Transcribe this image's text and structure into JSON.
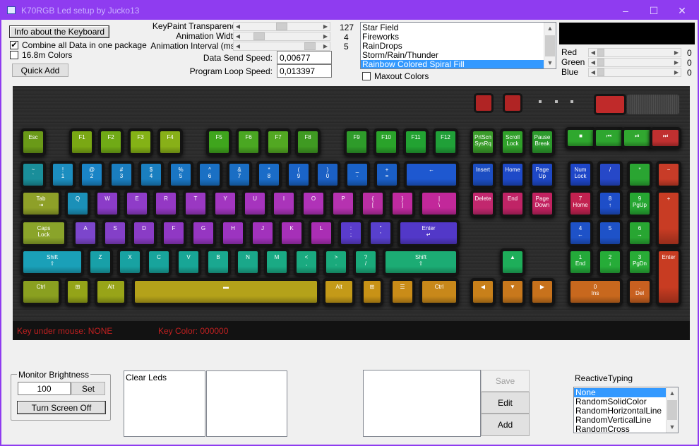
{
  "window": {
    "title": "K70RGB Led setup by Jucko13",
    "minimize": "‒",
    "maximize": "☐",
    "close": "✕"
  },
  "top": {
    "info_button": "Info about the Keyboard",
    "combine_label": "Combine all Data in one package",
    "combine_checked": "✔",
    "colors_label": "16.8m Colors",
    "quick_add": "Quick Add",
    "transparency_label": "KeyPaint Transparency",
    "transparency_value": "127",
    "width_label": "Animation Width:",
    "width_value": "4",
    "interval_label": "Animation Interval (ms):",
    "interval_value": "5",
    "send_label": "Data Send Speed:",
    "send_value": "0,00677",
    "loop_label": "Program Loop Speed:",
    "loop_value": "0,013397"
  },
  "effects": {
    "items": [
      "Star Field",
      "Fireworks",
      "RainDrops",
      "Storm/Rain/Thunder",
      "Rainbow Colored Spiral Fill"
    ],
    "selected": 4
  },
  "maxout_label": "Maxout Colors",
  "rgb": {
    "red_label": "Red",
    "green_label": "Green",
    "blue_label": "Blue",
    "red": "0",
    "green": "0",
    "blue": "0"
  },
  "keyboard": {
    "status_key": "Key under mouse: NONE",
    "status_color": "Key Color: 000000"
  },
  "monitor": {
    "title": "Monitor Brightness",
    "value": "100",
    "set": "Set",
    "turn_off": "Turn Screen Off"
  },
  "macros": {
    "items": [
      "Clear Leds"
    ]
  },
  "editor": {
    "save": "Save",
    "edit": "Edit",
    "add": "Add"
  },
  "reactive": {
    "title": "ReactiveTyping",
    "items": [
      "None",
      "RandomSolidColor",
      "RandomHorizontalLine",
      "RandomVerticalLine",
      "RandomCross"
    ],
    "selected": 0
  },
  "colors": {
    "accent": "#8f3cf0",
    "selection": "#3399ff",
    "status_text": "#c02020"
  },
  "keys": [
    {
      "l": "Esc",
      "b": "#6a9a18"
    },
    {
      "l": "F1",
      "b": "#7aa814"
    },
    {
      "l": "F2",
      "b": "#70aa16"
    },
    {
      "l": "F3",
      "b": "#84b216"
    },
    {
      "l": "F4",
      "b": "#88b018"
    },
    {
      "l": "F5",
      "b": "#3fa51d"
    },
    {
      "l": "F6",
      "b": "#4aa722"
    },
    {
      "l": "F7",
      "b": "#52a822"
    },
    {
      "l": "F8",
      "b": "#3f9a22"
    },
    {
      "l": "F9",
      "b": "#2e9b2a"
    },
    {
      "l": "F10",
      "b": "#2aa32a"
    },
    {
      "l": "F11",
      "b": "#22a232"
    },
    {
      "l": "F12",
      "b": "#20a038"
    },
    {
      "l": "PrtScn SysRq",
      "b": "#3a9b2a"
    },
    {
      "l": "Scroll Lock",
      "b": "#30a02a"
    },
    {
      "l": "Pause Break",
      "b": "#2c9a2c"
    },
    {
      "l": "■",
      "b": "#2fa82e"
    },
    {
      "l": "⏮",
      "b": "#2ea62f"
    },
    {
      "l": "⏯",
      "b": "#31a730"
    },
    {
      "l": "⏭",
      "b": "#c03030"
    },
    {
      "l": "~ `",
      "b": "#1a8e9a"
    },
    {
      "l": "! 1",
      "b": "#1c8ec0"
    },
    {
      "l": "@ 2",
      "b": "#1a84c6"
    },
    {
      "l": "# 3",
      "b": "#1a7ec0"
    },
    {
      "l": "$ 4",
      "b": "#1a7fc0"
    },
    {
      "l": "% 5",
      "b": "#1a76c4"
    },
    {
      "l": "^ 6",
      "b": "#1a70c4"
    },
    {
      "l": "& 7",
      "b": "#1a6ec4"
    },
    {
      "l": "* 8",
      "b": "#1a6cc8"
    },
    {
      "l": "( 9",
      "b": "#1a64c8"
    },
    {
      "l": ") 0",
      "b": "#1b60c4"
    },
    {
      "l": "_ -",
      "b": "#1a62c8"
    },
    {
      "l": "+ =",
      "b": "#1a5ec6"
    },
    {
      "l": "←",
      "b": "#1e58d0"
    },
    {
      "l": "Insert",
      "b": "#1c4ec2"
    },
    {
      "l": "Home",
      "b": "#1e4ac8"
    },
    {
      "l": "Page Up",
      "b": "#1e48c6"
    },
    {
      "l": "Num Lock",
      "b": "#1e46c8"
    },
    {
      "l": "/",
      "b": "#2648c8"
    },
    {
      "l": "*",
      "b": "#2aa532"
    },
    {
      "l": "−",
      "b": "#c83c28"
    },
    {
      "l": "Tab ⇥",
      "b": "#8ea028"
    },
    {
      "l": "Q",
      "b": "#1b90b8"
    },
    {
      "l": "W",
      "b": "#8b3cc8"
    },
    {
      "l": "E",
      "b": "#8f3cc8"
    },
    {
      "l": "R",
      "b": "#9438c4"
    },
    {
      "l": "T",
      "b": "#9a38c2"
    },
    {
      "l": "Y",
      "b": "#a236c0"
    },
    {
      "l": "U",
      "b": "#a634be"
    },
    {
      "l": "I",
      "b": "#aa34ba"
    },
    {
      "l": "O",
      "b": "#b032b8"
    },
    {
      "l": "P",
      "b": "#b632b0"
    },
    {
      "l": "{ [",
      "b": "#ba2ea4"
    },
    {
      "l": "} ]",
      "b": "#c02aa0"
    },
    {
      "l": "| \\",
      "b": "#c2289a"
    },
    {
      "l": "Delete",
      "b": "#c2286e"
    },
    {
      "l": "End",
      "b": "#c02466"
    },
    {
      "l": "Page Down",
      "b": "#c22260"
    },
    {
      "l": "7 Home",
      "b": "#c22250"
    },
    {
      "l": "8 ↑",
      "b": "#1e4ec8"
    },
    {
      "l": "9 PgUp",
      "b": "#26a632"
    },
    {
      "l": "+",
      "b": "#c83c24"
    },
    {
      "l": "Caps Lock",
      "b": "#8aa42a"
    },
    {
      "l": "A",
      "b": "#7c46cc"
    },
    {
      "l": "S",
      "b": "#8440c8"
    },
    {
      "l": "D",
      "b": "#8a3cc6"
    },
    {
      "l": "F",
      "b": "#9038c4"
    },
    {
      "l": "G",
      "b": "#9636c2"
    },
    {
      "l": "H",
      "b": "#9c34c0"
    },
    {
      "l": "J",
      "b": "#a232bc"
    },
    {
      "l": "K",
      "b": "#a630b8"
    },
    {
      "l": "L",
      "b": "#aa2eb4"
    },
    {
      "l": ": ;",
      "b": "#5a3ccc"
    },
    {
      "l": "\" '",
      "b": "#5840ce"
    },
    {
      "l": "Enter ↵",
      "b": "#5238c8"
    },
    {
      "l": "4 ←",
      "b": "#1e52c8"
    },
    {
      "l": "5",
      "b": "#1e52c8"
    },
    {
      "l": "6 →",
      "b": "#28a632"
    },
    {
      "l": "Shift ⇧",
      "b": "#1aa0b8"
    },
    {
      "l": "Z",
      "b": "#18a0a8"
    },
    {
      "l": "X",
      "b": "#18a2a2"
    },
    {
      "l": "C",
      "b": "#18a49c"
    },
    {
      "l": "V",
      "b": "#18a696"
    },
    {
      "l": "B",
      "b": "#1aa890"
    },
    {
      "l": "N",
      "b": "#1aa88a"
    },
    {
      "l": "M",
      "b": "#1aaa84"
    },
    {
      "l": "< ,",
      "b": "#1aaa80"
    },
    {
      "l": "> .",
      "b": "#1aaa7c"
    },
    {
      "l": "? /",
      "b": "#1aaa7a"
    },
    {
      "l": "Shift ⇧",
      "b": "#1cac74"
    },
    {
      "l": "▲",
      "b": "#1eae5a"
    },
    {
      "l": "1 End",
      "b": "#24aa3a"
    },
    {
      "l": "2 ↓",
      "b": "#26ac38"
    },
    {
      "l": "3 PgDn",
      "b": "#28ac36"
    },
    {
      "l": "Enter",
      "b": "#c83c22"
    },
    {
      "l": "Ctrl",
      "b": "#8aa020"
    },
    {
      "l": "⊞",
      "b": "#94a418"
    },
    {
      "l": "Alt",
      "b": "#98a418"
    },
    {
      "l": "▬",
      "b": "#b4a21a"
    },
    {
      "l": "Alt",
      "b": "#c49a18"
    },
    {
      "l": "⊞",
      "b": "#c89216"
    },
    {
      "l": "☰",
      "b": "#ca8c18"
    },
    {
      "l": "Ctrl",
      "b": "#c8881a"
    },
    {
      "l": "◀",
      "b": "#c8801a"
    },
    {
      "l": "▼",
      "b": "#c8781c"
    },
    {
      "l": "▶",
      "b": "#c8721c"
    },
    {
      "l": "0 Ins",
      "b": "#c8681e"
    },
    {
      "l": ". Del",
      "b": "#c86020"
    }
  ]
}
